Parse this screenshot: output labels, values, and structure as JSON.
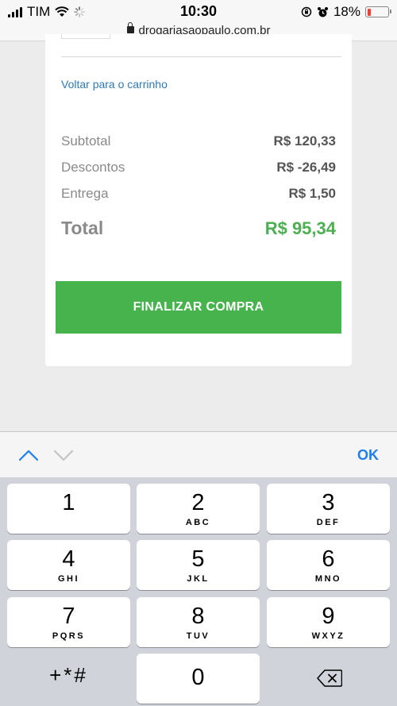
{
  "status_bar": {
    "carrier": "TIM",
    "time": "10:30",
    "battery": "18%",
    "battery_level": 0.18
  },
  "browser": {
    "url": "drogariasaopaulo.com.br"
  },
  "cart": {
    "back_link": "Voltar para o carrinho",
    "summary": [
      {
        "label": "Subtotal",
        "value": "R$ 120,33"
      },
      {
        "label": "Descontos",
        "value": "R$ -26,49"
      },
      {
        "label": "Entrega",
        "value": "R$ 1,50"
      }
    ],
    "total_label": "Total",
    "total_value": "R$ 95,34",
    "finalize_label": "FINALIZAR COMPRA"
  },
  "keyboard": {
    "ok_label": "OK",
    "keys": [
      {
        "digit": "1",
        "letters": ""
      },
      {
        "digit": "2",
        "letters": "ABC"
      },
      {
        "digit": "3",
        "letters": "DEF"
      },
      {
        "digit": "4",
        "letters": "GHI"
      },
      {
        "digit": "5",
        "letters": "JKL"
      },
      {
        "digit": "6",
        "letters": "MNO"
      },
      {
        "digit": "7",
        "letters": "PQRS"
      },
      {
        "digit": "8",
        "letters": "TUV"
      },
      {
        "digit": "9",
        "letters": "WXYZ"
      },
      {
        "digit": "0",
        "letters": ""
      }
    ],
    "symbols_label": "+*#"
  },
  "colors": {
    "accent_green": "#46b34d",
    "total_green": "#4caf50",
    "link_blue": "#2f7ab5",
    "ios_blue": "#1d7ff0"
  }
}
